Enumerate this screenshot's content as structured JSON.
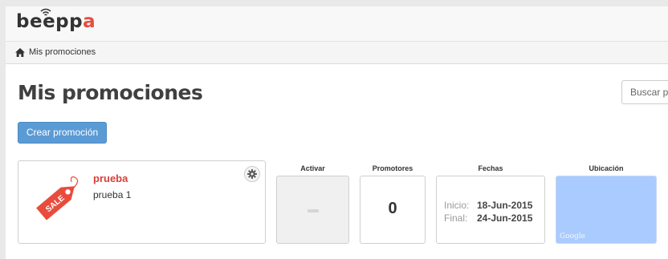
{
  "app": {
    "logo_text_start": "bee",
    "logo_text_mid": "pp",
    "logo_text_end": "a"
  },
  "breadcrumb": {
    "label": "Mis promociones"
  },
  "page": {
    "title": "Mis promociones"
  },
  "search": {
    "placeholder": "Buscar p"
  },
  "toolbar": {
    "create_label": "Crear promoción"
  },
  "promotion": {
    "name": "prueba",
    "description": "prueba 1",
    "tag_text": "SALE"
  },
  "columns": {
    "activar": "Activar",
    "promotores": "Promotores",
    "fechas": "Fechas",
    "ubicacion": "Ubicación"
  },
  "promotores_count": "0",
  "dates": {
    "start_label": "Inicio:",
    "start_value": "18-Jun-2015",
    "end_label": "Final:",
    "end_value": "24-Jun-2015"
  },
  "map": {
    "attribution": "Google"
  },
  "colors": {
    "accent": "#5b9bd5",
    "brand": "#e84c3d",
    "promo_name": "#d9403a",
    "map": "#aacbff"
  },
  "icons": [
    "wifi-icon",
    "home-icon",
    "sale-tag-icon",
    "gear-icon"
  ]
}
